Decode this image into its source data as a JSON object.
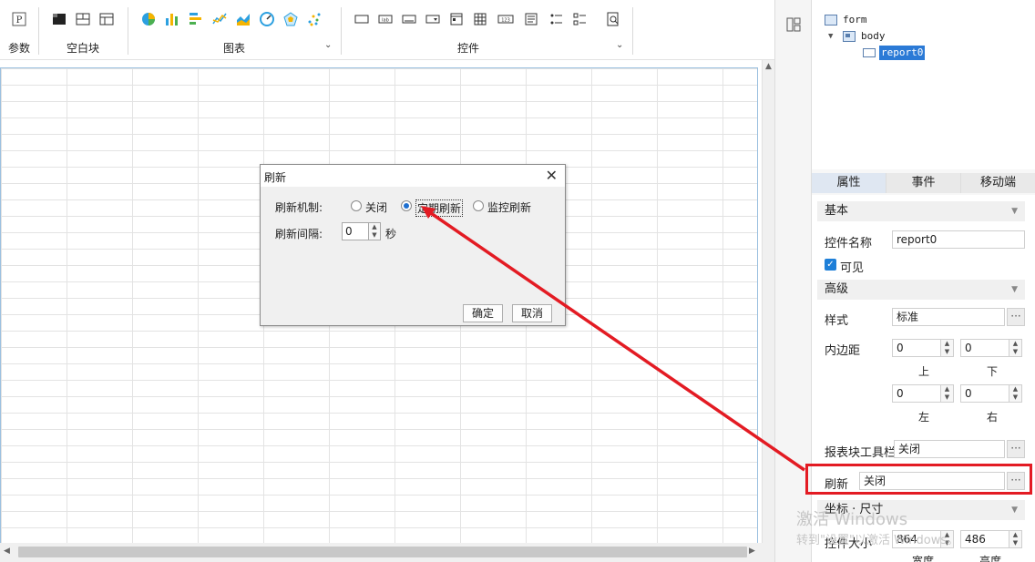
{
  "toolbar": {
    "param_label": "参数",
    "blank_label": "空白块",
    "chart_label": "图表",
    "widget_label": "控件",
    "widget_icons": [
      "button-icon",
      "label-icon",
      "text-field-icon",
      "combo-icon",
      "date-icon",
      "grid-icon",
      "number-icon",
      "textarea-icon",
      "list-icon",
      "checkbox-group-icon",
      "tree-icon"
    ]
  },
  "tree": {
    "root": "form",
    "child": "body",
    "leaf": "report0"
  },
  "tabs": [
    "属性",
    "事件",
    "移动端"
  ],
  "props": {
    "section_basic": "基本",
    "name_label": "控件名称",
    "name_value": "report0",
    "visible_label": "可见",
    "section_advanced": "高级",
    "style_label": "样式",
    "style_value": "标准",
    "padding_label": "内边距",
    "pad_top": "0",
    "pad_bottom": "0",
    "pad_left": "0",
    "pad_right": "0",
    "top_label": "上",
    "bottom_label": "下",
    "left_label": "左",
    "right_label": "右",
    "toolbar_label": "报表块工具栏",
    "toolbar_value": "关闭",
    "refresh_label": "刷新",
    "refresh_value": "关闭",
    "section_coords": "坐标 · 尺寸",
    "size_label": "控件大小",
    "width_value": "864",
    "height_value": "486",
    "width_label": "宽度",
    "height_label": "高度",
    "more": "···"
  },
  "watermark": {
    "line1": "激活 Windows",
    "line2": "转到\"设置\"以激活 Windows。"
  },
  "dialog": {
    "title": "刷新",
    "close": "✕",
    "mechanism_label": "刷新机制:",
    "opt_off": "关闭",
    "opt_timed": "定期刷新",
    "opt_monitor": "监控刷新",
    "interval_label": "刷新间隔:",
    "interval_value": "0",
    "unit": "秒",
    "ok": "确定",
    "cancel": "取消"
  },
  "colors": {
    "accent": "#1e7fd8",
    "highlight": "#e31b23"
  }
}
